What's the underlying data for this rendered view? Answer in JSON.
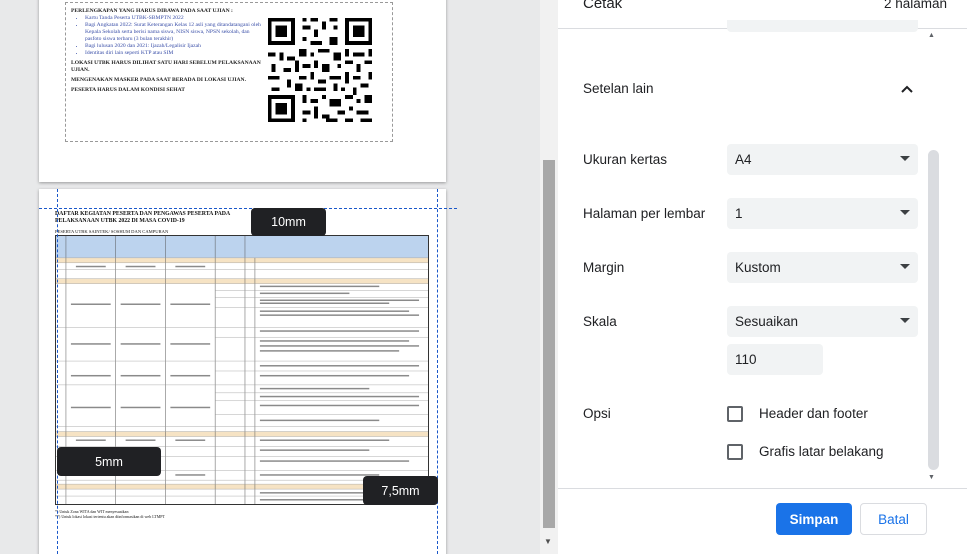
{
  "header": {
    "title": "Cetak",
    "pages": "2 halaman"
  },
  "more_settings": {
    "label": "Setelan lain"
  },
  "paper_size": {
    "label": "Ukuran kertas",
    "value": "A4"
  },
  "pages_per_sheet": {
    "label": "Halaman per lembar",
    "value": "1"
  },
  "margins": {
    "label": "Margin",
    "value": "Kustom"
  },
  "scale": {
    "label": "Skala",
    "value": "Sesuaikan",
    "custom_value": "110"
  },
  "options": {
    "label": "Opsi",
    "items": [
      {
        "label": "Header dan footer",
        "checked": false
      },
      {
        "label": "Grafis latar belakang",
        "checked": false
      }
    ]
  },
  "buttons": {
    "save": "Simpan",
    "cancel": "Batal"
  },
  "margin_tags": {
    "top": "10mm",
    "left": "5mm",
    "right": "7,5mm"
  },
  "preview": {
    "page1": {
      "items": [
        "PERLENGKAPAN YANG HARUS DIBAWA PADA SAAT UJIAN :",
        "Kartu Tanda Peserta UTBK-SBMPTN 2022",
        "Bagi Angkatan 2022: Surat Keterangan Kelas 12 asli yang ditandatangani oleh Kepala Sekolah serta berisi nama siswa, NISN siswa, NPSN sekolah, dan pasfoto siswa terbaru (3 bulan terakhir)",
        "Bagi lulusan 2020 dan 2021: Ijazah/Legalisir Ijazah",
        "Identitas diri lain seperti KTP atau SIM",
        "LOKASI UTBK HARUS DILIHAT SATU HARI SEBELUM PELAKSANAAN UJIAN.",
        "MENGENAKAN MASKER PADA SAAT BERADA DI LOKASI UJIAN.",
        "PESERTA HARUS DALAM KONDISI SEHAT"
      ]
    },
    "page2": {
      "title": "DAFTAR KEGIATAN PESERTA DAN PENGAWAS PESERTA PADA PELAKSANAAN UTBK 2022 DI MASA COVID-19",
      "subtitle": "PESERTA UTBK SAINTEK/ SOSHUM DAN CAMPURAN",
      "footnotes": [
        "*) Untuk Zona WITA dan WIT menyesuaikan",
        "**) Untuk lokasi lokasi tertentu akan diinformasikan di web LTMPT"
      ]
    }
  }
}
